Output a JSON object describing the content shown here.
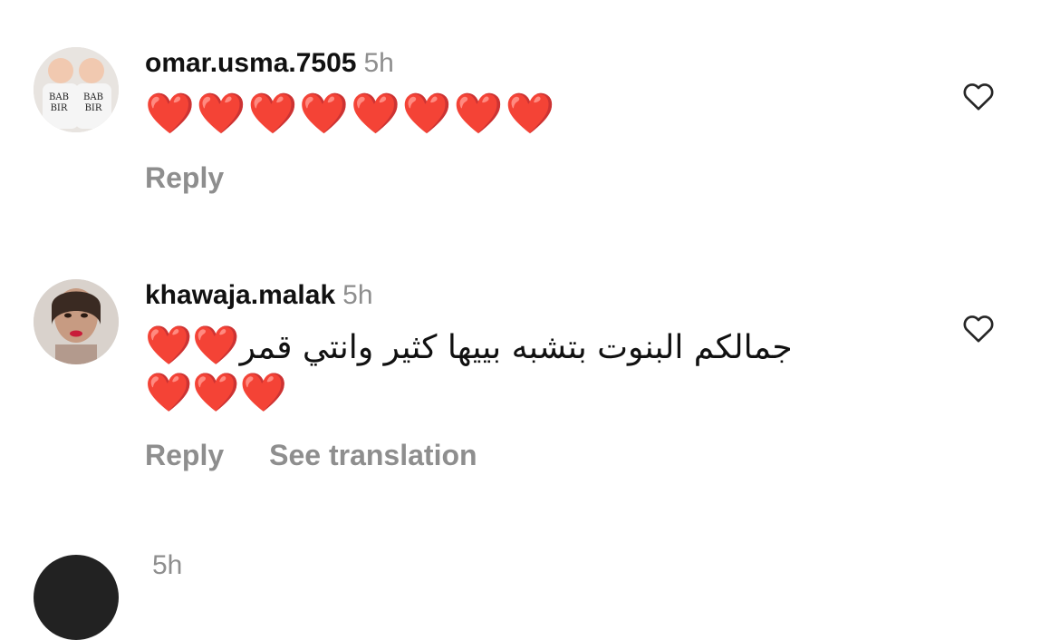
{
  "comments": [
    {
      "username": "omar.usma.7505",
      "time": "5h",
      "text": "❤️❤️❤️❤️❤️❤️❤️❤️",
      "reply_label": "Reply",
      "avatar_text": [
        "BAB",
        "BIR",
        "BAB",
        "BIR"
      ]
    },
    {
      "username": "khawaja.malak",
      "time": "5h",
      "text_line1": "جمالكم البنوت بتشبه بييها كثير وانتي قمر",
      "hearts_line1": "❤️❤️",
      "hearts_line2": "❤️❤️❤️",
      "reply_label": "Reply",
      "translation_label": "See translation"
    },
    {
      "username": "",
      "time": "5h"
    }
  ],
  "colors": {
    "heart": "#e60012",
    "muted": "#8e8e8e",
    "text": "#111111"
  }
}
